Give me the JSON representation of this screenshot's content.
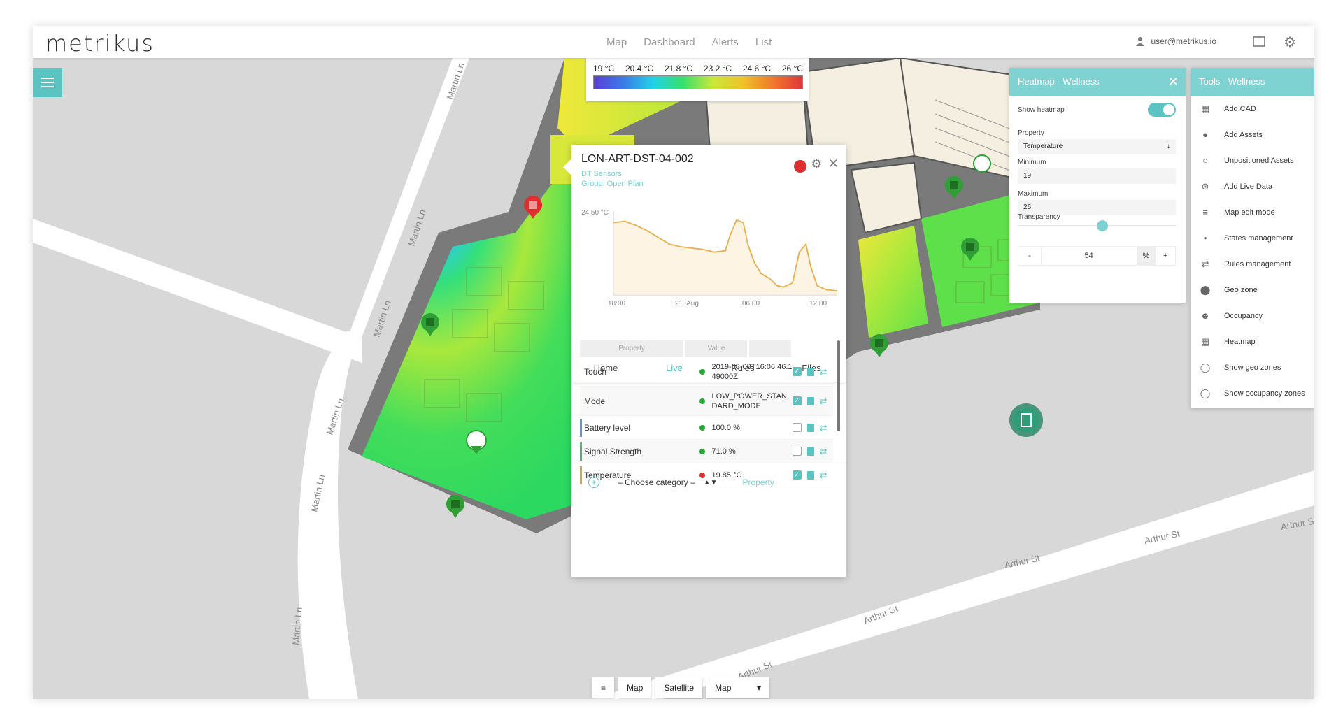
{
  "app": {
    "logo": "metrikus"
  },
  "nav": {
    "items": [
      "Map",
      "Dashboard",
      "Alerts",
      "List"
    ],
    "active": "Map"
  },
  "user": {
    "email": "user@metrikus.io"
  },
  "legend": {
    "ticks": [
      "19 °C",
      "20.4 °C",
      "21.8 °C",
      "23.2 °C",
      "24.6 °C",
      "26 °C"
    ]
  },
  "roads": {
    "martin_labels": [
      "Martin Ln",
      "Martin Ln",
      "Martin Ln",
      "Martin Ln",
      "Martin Ln",
      "Martin Ln"
    ],
    "arthur_labels": [
      "Arthur St",
      "Arthur St",
      "Arthur St",
      "Arthur St",
      "Arthur St"
    ]
  },
  "device": {
    "name": "LON-ART-DST-04-002",
    "type": "DT Sensors",
    "group": "Group: Open Plan",
    "status_color": "#e02d2d"
  },
  "chart_data": {
    "type": "line",
    "y_label": "24.50 °C",
    "x_ticks": [
      "18:00",
      "21. Aug",
      "06:00",
      "12:00"
    ],
    "series": [
      {
        "color": "#e8b04a",
        "x": [
          0,
          5,
          10,
          15,
          20,
          25,
          30,
          35,
          40,
          45,
          50,
          52,
          55,
          58,
          60,
          63,
          66,
          70,
          73,
          76,
          80,
          83,
          86,
          88,
          91,
          95,
          100
        ],
        "y": [
          24.4,
          24.5,
          24.2,
          23.8,
          23.3,
          22.8,
          22.6,
          22.5,
          22.4,
          22.2,
          22.3,
          23.4,
          24.6,
          24.4,
          22.8,
          21.4,
          20.6,
          20.2,
          19.7,
          19.6,
          19.9,
          22.2,
          22.8,
          21.2,
          19.7,
          19.4,
          19.3
        ]
      }
    ],
    "xlim": [
      0,
      100
    ],
    "ylim": [
      19,
      25
    ]
  },
  "tabs": [
    "Home",
    "Live",
    "Rules",
    "Files"
  ],
  "active_tab": "Live",
  "table": {
    "headers": [
      "Property",
      "Value"
    ],
    "rows": [
      {
        "name": "Touch",
        "value": "2019-08-08T16:06:46.149000Z",
        "dot": "#22aa33",
        "checked": true,
        "stripe": ""
      },
      {
        "name": "Mode",
        "value": "LOW_POWER_STANDARD_MODE",
        "dot": "#22aa33",
        "checked": true,
        "stripe": ""
      },
      {
        "name": "Battery level",
        "value": "100.0 %",
        "dot": "#22aa33",
        "checked": false,
        "stripe": "#4a9fe0"
      },
      {
        "name": "Signal Strength",
        "value": "71.0 %",
        "dot": "#22aa33",
        "checked": false,
        "stripe": "#3bbf6a"
      },
      {
        "name": "Temperature",
        "value": "19.85 °C",
        "dot": "#e02d2d",
        "checked": true,
        "stripe": "#f0a020"
      }
    ]
  },
  "footer": {
    "category": "– Choose category –",
    "property": "Property"
  },
  "heatmap_panel": {
    "title": "Heatmap - Wellness",
    "show_heatmap_label": "Show heatmap",
    "show_heatmap": true,
    "property_label": "Property",
    "property_value": "Temperature",
    "min_label": "Minimum",
    "min_value": "19",
    "max_label": "Maximum",
    "max_value": "26",
    "transparency_label": "Transparency",
    "transparency_value": "54",
    "transparency_fraction": 0.54,
    "minus": "-",
    "plus": "+",
    "percent": "%"
  },
  "tools_panel": {
    "title": "Tools - Wellness",
    "items": [
      {
        "label": "Add CAD",
        "icon": "map-icon"
      },
      {
        "label": "Add Assets",
        "icon": "pin-icon"
      },
      {
        "label": "Unpositioned Assets",
        "icon": "pin-outline-icon"
      },
      {
        "label": "Add Live Data",
        "icon": "signal-icon"
      },
      {
        "label": "Map edit mode",
        "icon": "sliders-icon"
      },
      {
        "label": "States management",
        "icon": "broadcast-icon"
      },
      {
        "label": "Rules management",
        "icon": "shuffle-icon"
      },
      {
        "label": "Geo zone",
        "icon": "circle-icon"
      },
      {
        "label": "Occupancy",
        "icon": "people-icon"
      },
      {
        "label": "Heatmap",
        "icon": "map-icon"
      },
      {
        "label": "Show geo zones",
        "icon": "radio-icon"
      },
      {
        "label": "Show occupancy zones",
        "icon": "radio-icon"
      }
    ]
  },
  "map_controls": {
    "map": "Map",
    "satellite": "Satellite",
    "select": "Map"
  }
}
